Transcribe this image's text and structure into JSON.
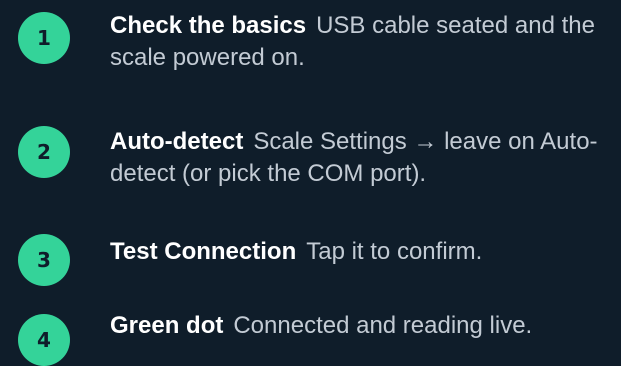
{
  "steps": [
    {
      "number": "1",
      "title": "Check the basics",
      "description": "USB cable seated and the scale powered on."
    },
    {
      "number": "2",
      "title": "Auto-detect",
      "description": "Scale Settings → leave on Auto-detect (or pick the COM port)."
    },
    {
      "number": "3",
      "title": "Test Connection",
      "description": "Tap it to confirm."
    },
    {
      "number": "4",
      "title": "Green dot",
      "description": "Connected and reading live."
    }
  ],
  "colors": {
    "background": "#0f1d2a",
    "badge": "#34d399",
    "title_text": "#ffffff",
    "body_text": "#c3cbd4"
  }
}
